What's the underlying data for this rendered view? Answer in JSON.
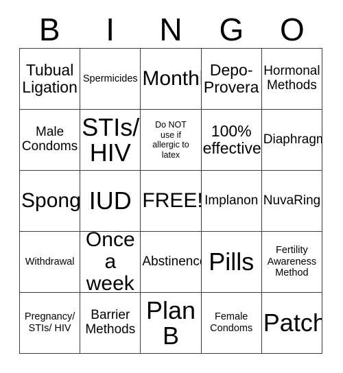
{
  "card": {
    "title": "BINGO card",
    "header_letters": [
      "B",
      "I",
      "N",
      "G",
      "O"
    ],
    "grid_size": "5x5",
    "free_space": "FREE!",
    "rows": [
      [
        {
          "text": "Tubual\nLigation",
          "size": "lg"
        },
        {
          "text": "Spermicides",
          "size": "sm"
        },
        {
          "text": "Monthly",
          "size": "xl"
        },
        {
          "text": "Depo-\nProvera",
          "size": "lg"
        },
        {
          "text": "Hormonal\nMethods",
          "size": "md"
        }
      ],
      [
        {
          "text": "Male\nCondoms",
          "size": "md"
        },
        {
          "text": "STIs/\nHIV",
          "size": "xxl"
        },
        {
          "text": "Do NOT\nuse if\nallergic to\nlatex",
          "size": "xs"
        },
        {
          "text": "100%\neffective",
          "size": "lg"
        },
        {
          "text": "Diaphragm",
          "size": "md"
        }
      ],
      [
        {
          "text": "Sponge",
          "size": "xl"
        },
        {
          "text": "IUD",
          "size": "xxl"
        },
        {
          "text": "FREE!",
          "size": "xl"
        },
        {
          "text": "Implanon",
          "size": "md"
        },
        {
          "text": "NuvaRing",
          "size": "md"
        }
      ],
      [
        {
          "text": "Withdrawal",
          "size": "sm"
        },
        {
          "text": "Once\na week",
          "size": "xl"
        },
        {
          "text": "Abstinence",
          "size": "md"
        },
        {
          "text": "Pills",
          "size": "xxl"
        },
        {
          "text": "Fertility\nAwareness\nMethod",
          "size": "sm"
        }
      ],
      [
        {
          "text": "Pregnancy/\nSTIs/ HIV",
          "size": "sm"
        },
        {
          "text": "Barrier\nMethods",
          "size": "md"
        },
        {
          "text": "Plan\nB",
          "size": "xxl"
        },
        {
          "text": "Female\nCondoms",
          "size": "sm"
        },
        {
          "text": "Patch",
          "size": "xxl"
        }
      ]
    ]
  },
  "colors": {
    "background": "#ffffff",
    "text": "#000000",
    "border": "#3a3a3a"
  }
}
